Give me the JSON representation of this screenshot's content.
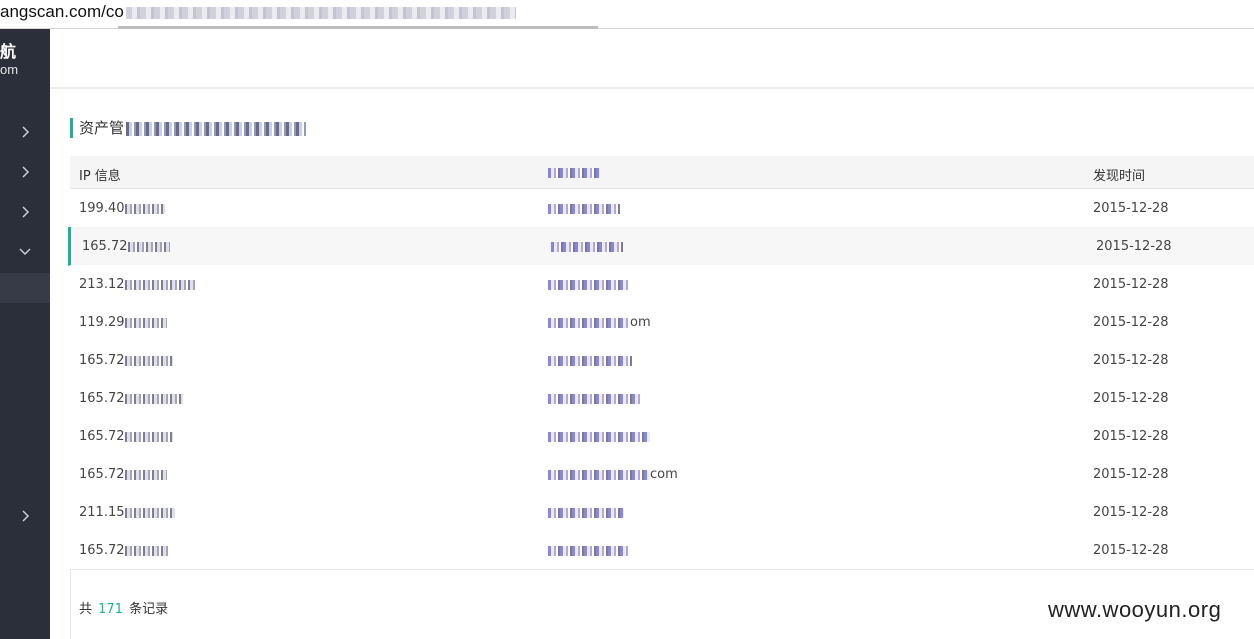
{
  "browser": {
    "url_prefix": "angscan.com/co"
  },
  "sidebar": {
    "brand_title": "航",
    "brand_sub": "om",
    "items": [
      {
        "icon": "chevron-right-icon"
      },
      {
        "icon": "chevron-right-icon"
      },
      {
        "icon": "chevron-right-icon"
      },
      {
        "icon": "chevron-down-icon"
      },
      {
        "icon": "chevron-right-icon"
      }
    ]
  },
  "page": {
    "title_prefix": "资产管"
  },
  "table": {
    "headers": {
      "ip": "IP 信息",
      "domain": "",
      "time": "发现时间"
    },
    "rows": [
      {
        "ip": "199.40",
        "domain_suffix": "",
        "time": "2015-12-28"
      },
      {
        "ip": "165.72",
        "domain_suffix": "",
        "time": "2015-12-28"
      },
      {
        "ip": "213.12",
        "domain_suffix": "",
        "time": "2015-12-28"
      },
      {
        "ip": "119.29",
        "domain_suffix": "om",
        "time": "2015-12-28"
      },
      {
        "ip": "165.72",
        "domain_suffix": "",
        "time": "2015-12-28"
      },
      {
        "ip": "165.72",
        "domain_suffix": "",
        "time": "2015-12-28"
      },
      {
        "ip": "165.72",
        "domain_suffix": "",
        "time": "2015-12-28"
      },
      {
        "ip": "165.72",
        "domain_suffix": "com",
        "time": "2015-12-28"
      },
      {
        "ip": "211.15",
        "domain_suffix": "",
        "time": "2015-12-28"
      },
      {
        "ip": "165.72",
        "domain_suffix": "",
        "time": "2015-12-28"
      }
    ]
  },
  "footer": {
    "total_prefix": "共",
    "total_count": "171",
    "total_suffix": "条记录",
    "watermark": "www.wooyun.org"
  },
  "colors": {
    "accent": "#1ab394",
    "sidebar_bg": "#2b2f3a"
  }
}
